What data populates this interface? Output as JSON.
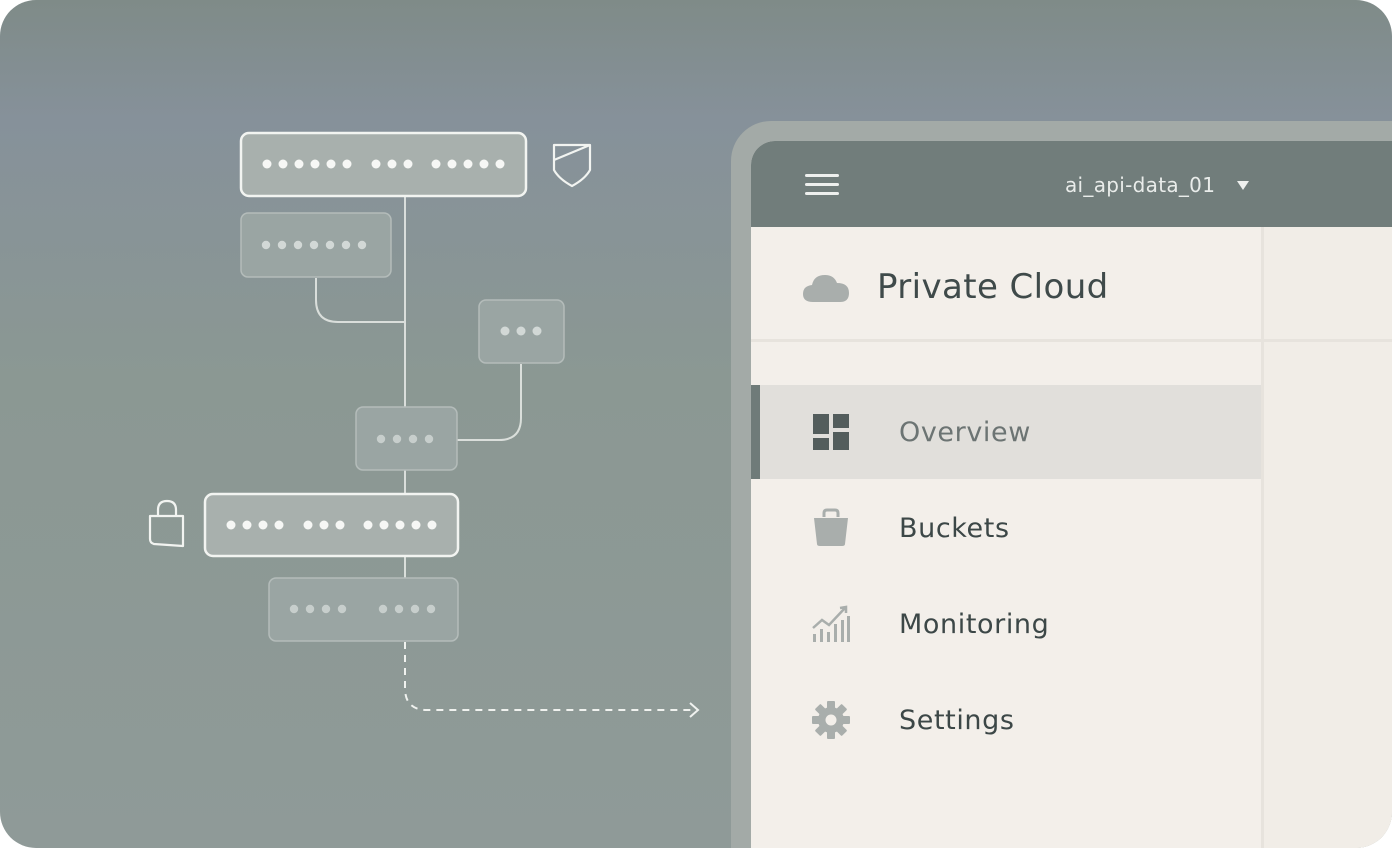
{
  "header": {
    "bucket_selector": "ai_api-data_01"
  },
  "brand": {
    "name": "Private Cloud",
    "icon": "cloud-icon"
  },
  "nav": {
    "items": [
      {
        "label": "Overview",
        "icon": "dashboard-icon",
        "active": true
      },
      {
        "label": "Buckets",
        "icon": "bucket-icon",
        "active": false
      },
      {
        "label": "Monitoring",
        "icon": "chart-icon",
        "active": false
      },
      {
        "label": "Settings",
        "icon": "gear-icon",
        "active": false
      }
    ]
  },
  "diagram": {
    "icons": [
      "shield-icon",
      "lock-icon"
    ]
  },
  "colors": {
    "background": "#8b9893",
    "topbar": "#717d7b",
    "sidebar": "#f3efea",
    "active_item": "#e1dfdb",
    "active_indicator": "#6f7b79",
    "text": "#3c4747"
  }
}
